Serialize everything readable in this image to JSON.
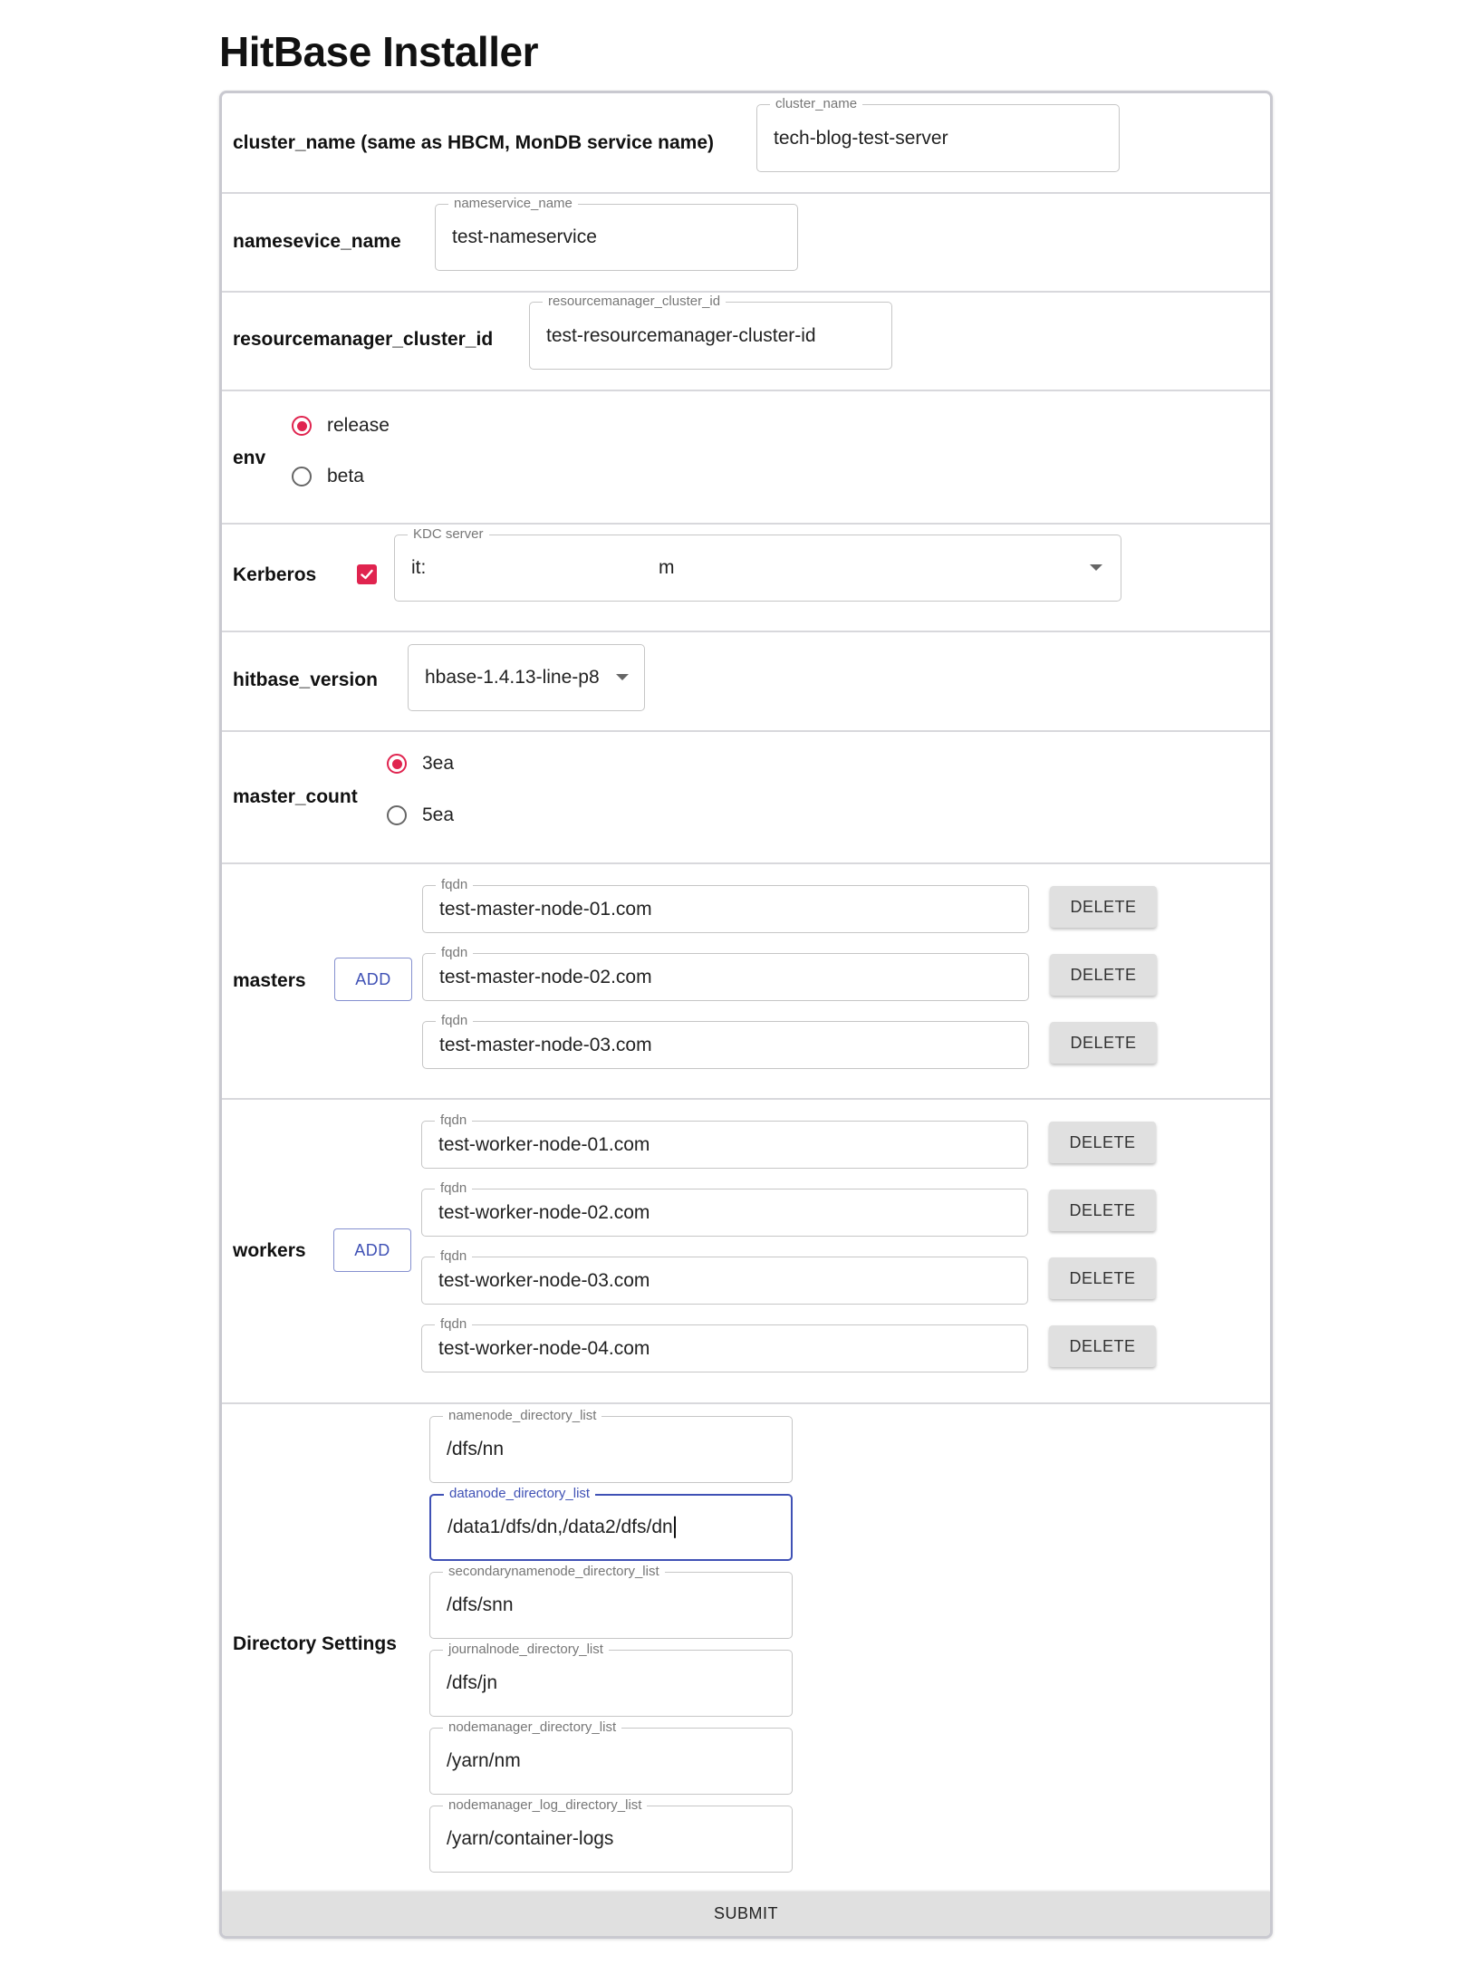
{
  "app": {
    "title": "HitBase Installer"
  },
  "cluster": {
    "label": "cluster_name (same as HBCM, MonDB service name)",
    "legend": "cluster_name",
    "value": "tech-blog-test-server"
  },
  "nameservice": {
    "label": "namesevice_name",
    "legend": "nameservice_name",
    "value": "test-nameservice"
  },
  "resourcemanager": {
    "label": "resourcemanager_cluster_id",
    "legend": "resourcemanager_cluster_id",
    "value": "test-resourcemanager-cluster-id"
  },
  "env": {
    "label": "env",
    "options": [
      "release",
      "beta"
    ],
    "selected": "release"
  },
  "kerberos": {
    "label": "Kerberos",
    "checked": true,
    "kdc_legend": "KDC server",
    "kdc_value": "it:                                            m"
  },
  "hitbase_version": {
    "label": "hitbase_version",
    "value": "hbase-1.4.13-line-p8"
  },
  "master_count": {
    "label": "master_count",
    "options": [
      "3ea",
      "5ea"
    ],
    "selected": "3ea"
  },
  "masters": {
    "label": "masters",
    "add_label": "ADD",
    "delete_label": "DELETE",
    "field_legend": "fqdn",
    "items": [
      "test-master-node-01.com",
      "test-master-node-02.com",
      "test-master-node-03.com"
    ]
  },
  "workers": {
    "label": "workers",
    "add_label": "ADD",
    "delete_label": "DELETE",
    "field_legend": "fqdn",
    "items": [
      "test-worker-node-01.com",
      "test-worker-node-02.com",
      "test-worker-node-03.com",
      "test-worker-node-04.com"
    ]
  },
  "directory": {
    "label": "Directory Settings",
    "fields": [
      {
        "legend": "namenode_directory_list",
        "value": "/dfs/nn"
      },
      {
        "legend": "datanode_directory_list",
        "value": "/data1/dfs/dn,/data2/dfs/dn"
      },
      {
        "legend": "secondarynamenode_directory_list",
        "value": "/dfs/snn"
      },
      {
        "legend": "journalnode_directory_list",
        "value": "/dfs/jn"
      },
      {
        "legend": "nodemanager_directory_list",
        "value": "/yarn/nm"
      },
      {
        "legend": "nodemanager_log_directory_list",
        "value": "/yarn/container-logs"
      }
    ]
  },
  "submit": {
    "label": "SUBMIT"
  },
  "colors": {
    "accent": "#e0244f",
    "primary": "#3f51b5"
  }
}
